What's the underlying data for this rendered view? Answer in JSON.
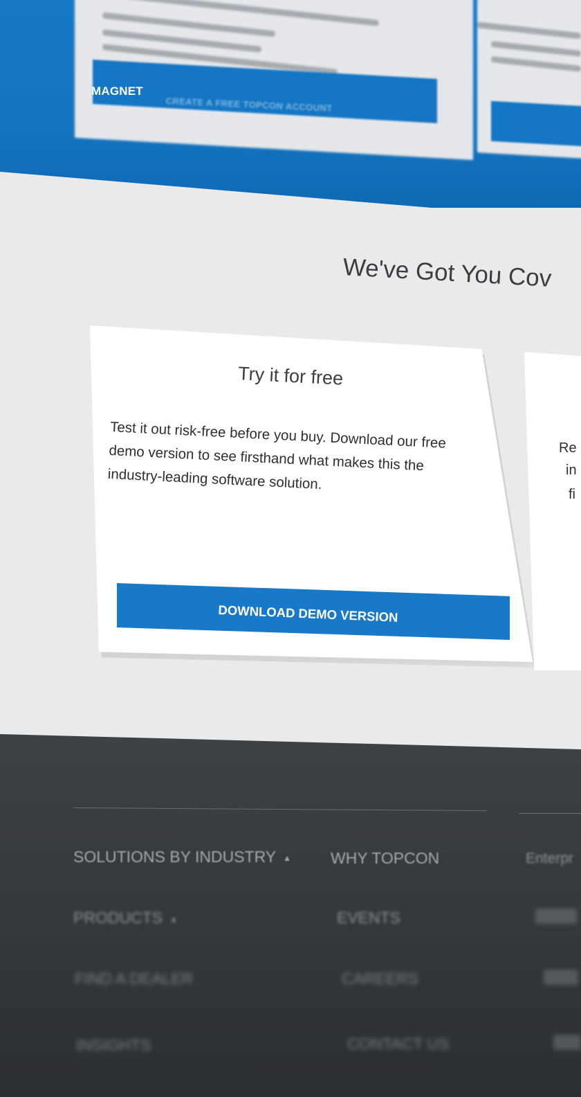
{
  "brand": {
    "label": "MAGNET"
  },
  "top_section": {
    "create_account_button": "CREATE A FREE TOPCON ACCOUNT"
  },
  "main": {
    "section_title": "We've Got You Cov",
    "card": {
      "title": "Try it for free",
      "body": "Test it out risk-free before you buy. Download our free demo version to see firsthand what makes this the industry-leading software solution.",
      "button_label": "DOWNLOAD DEMO VERSION"
    },
    "next_card_fragments": [
      "Re",
      "in",
      "fi"
    ]
  },
  "footer": {
    "col1": [
      {
        "label": "SOLUTIONS BY INDUSTRY",
        "chevron": "▲"
      },
      {
        "label": "PRODUCTS",
        "chevron": "▲"
      },
      {
        "label": "FIND A DEALER",
        "chevron": ""
      },
      {
        "label": "INSIGHTS",
        "chevron": ""
      }
    ],
    "col2": [
      "WHY TOPCON",
      "EVENTS",
      "CAREERS",
      "CONTACT US"
    ],
    "col3_fragment": "Enterpr"
  },
  "colors": {
    "brand_blue": "#1779c8",
    "footer_bg": "#36393c",
    "page_bg": "#e9eaeb"
  }
}
